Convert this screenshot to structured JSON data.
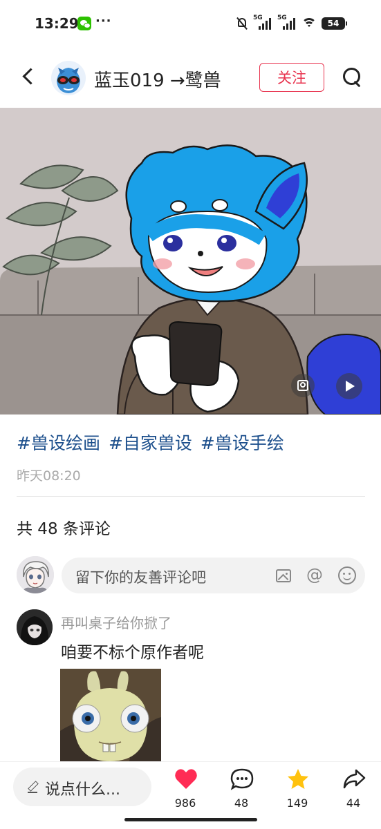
{
  "status_bar": {
    "time": "13:29",
    "dots": "···",
    "net1": "5G",
    "net2": "5G",
    "battery": "54",
    "icons": [
      "wechat-icon",
      "mute-icon",
      "signal-icon",
      "wifi-icon",
      "battery-icon"
    ]
  },
  "header": {
    "author": "蓝玉019 →鹭兽",
    "follow_label": "关注",
    "icons": [
      "back-icon",
      "search-icon"
    ]
  },
  "post": {
    "tags": [
      "#兽设绘画",
      "#自家兽设",
      "#兽设手绘"
    ],
    "time": "昨天08:20",
    "media_icons": [
      "scan-icon",
      "play-icon"
    ]
  },
  "comments": {
    "count_label": "共 48 条评论",
    "input_placeholder": "留下你的友善评论吧",
    "input_icons": [
      "image-icon",
      "at-icon",
      "emoji-icon"
    ],
    "at_glyph": "@",
    "items": [
      {
        "user": "再叫桌子给你掀了",
        "text": "咱要不标个原作者呢"
      }
    ]
  },
  "bottom_bar": {
    "input_label": "说点什么...",
    "like_count": "986",
    "comment_count": "48",
    "collect_count": "149",
    "share_count": "44"
  },
  "colors": {
    "accent": "#e8344f",
    "tag_blue": "#1c4f8c",
    "star": "#ffc20e",
    "heart": "#ff2c55"
  }
}
